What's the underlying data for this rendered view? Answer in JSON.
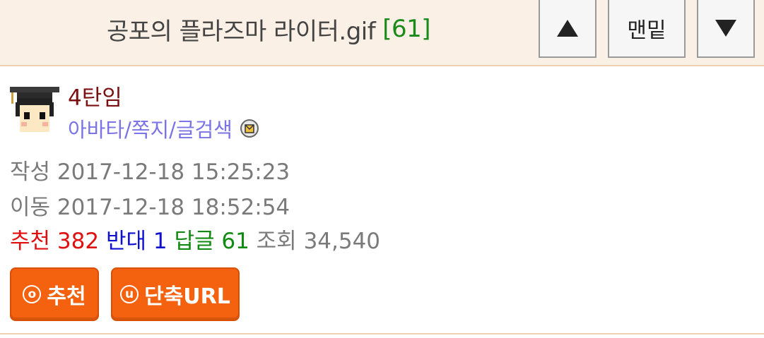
{
  "header": {
    "title": "공포의 플라즈마 라이터.gif",
    "comment_count": "[61]",
    "up_icon": "up-triangle-icon",
    "bottom_label": "맨밑",
    "down_icon": "down-triangle-icon"
  },
  "author": {
    "nickname": "4탄임",
    "links": "아바타/쪽지/글검색",
    "mail_icon": "mail-icon",
    "avatar_icon": "graduate-avatar"
  },
  "meta": {
    "write_label": "작성",
    "write_time": "2017-12-18 15:25:23",
    "move_label": "이동",
    "move_time": "2017-12-18 18:52:54"
  },
  "stats": {
    "recommend_label": "추천",
    "recommend_value": "382",
    "oppose_label": "반대",
    "oppose_value": "1",
    "reply_label": "답글",
    "reply_value": "61",
    "view_label": "조회",
    "view_value": "34,540"
  },
  "buttons": {
    "recommend_icon_char": "o",
    "recommend_label": "추천",
    "shorturl_icon_char": "u",
    "shorturl_label": "단축URL"
  },
  "colors": {
    "accent_orange": "#f4620f",
    "recommend": "#e01010",
    "oppose": "#1010d0",
    "reply": "#108a10",
    "nickname": "#7a1010",
    "links": "#7b74e6"
  }
}
